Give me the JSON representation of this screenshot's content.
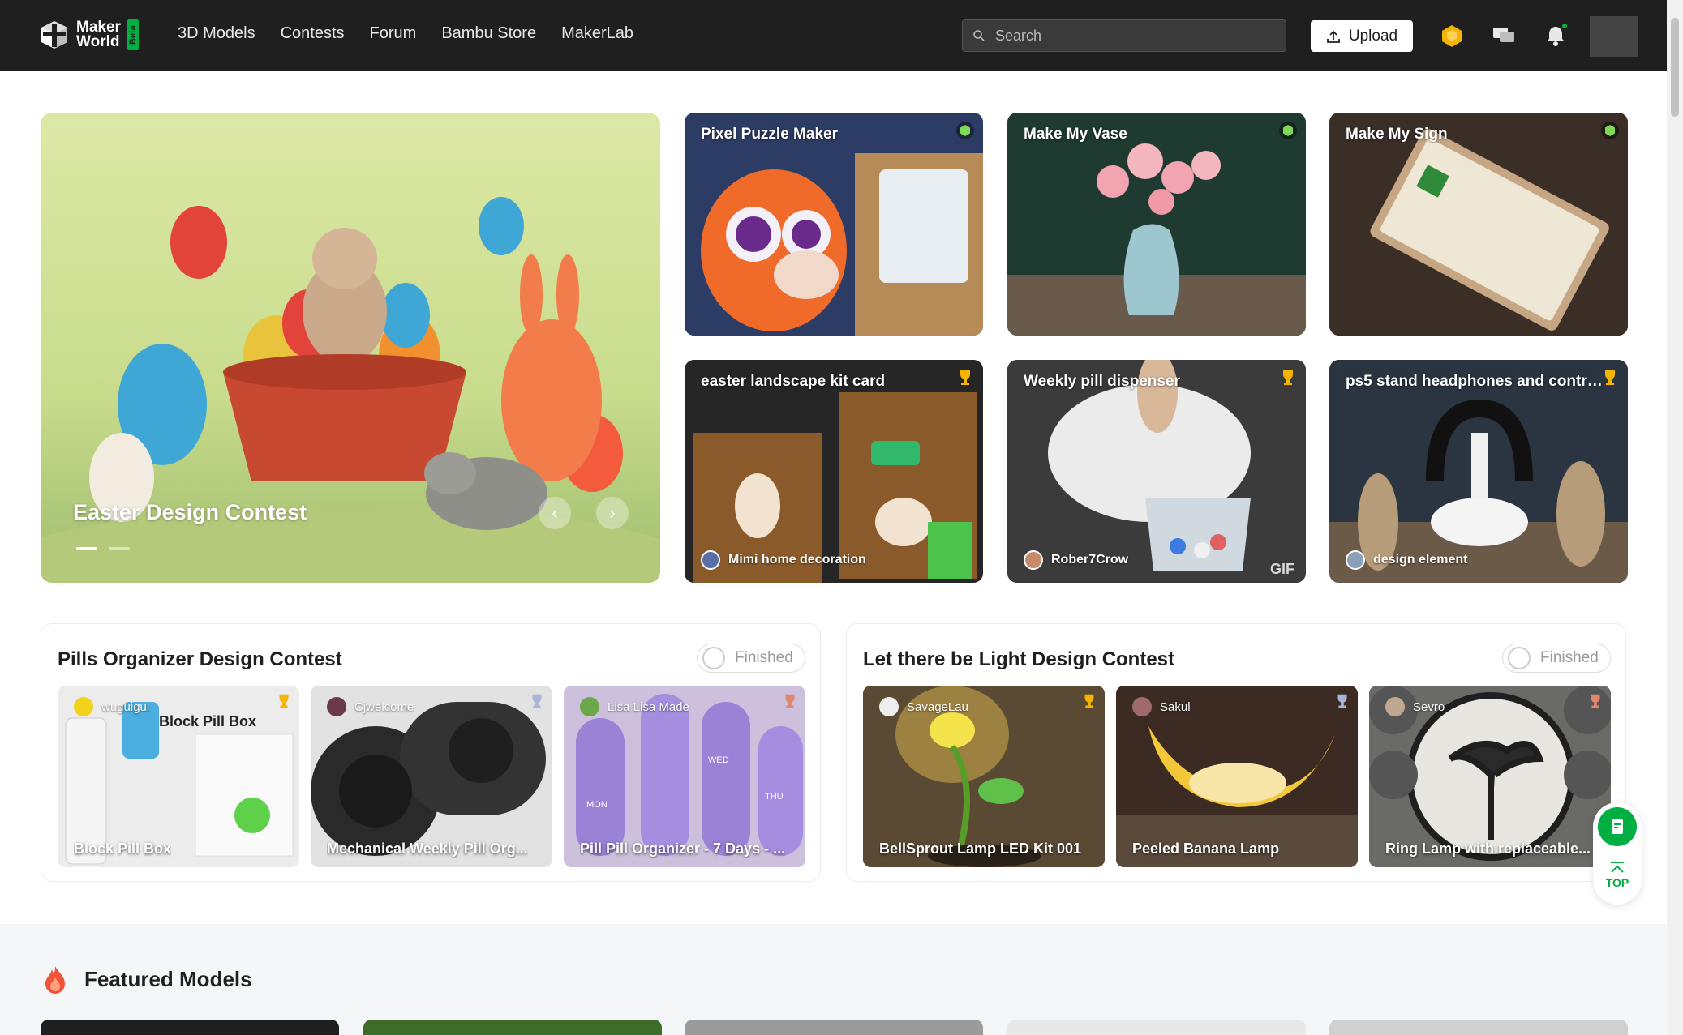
{
  "nav": {
    "logo_line1": "Maker",
    "logo_line2": "World",
    "beta": "Beta",
    "menu": [
      "3D Models",
      "Contests",
      "Forum",
      "Bambu Store",
      "MakerLab"
    ],
    "search_placeholder": "Search",
    "upload_label": "Upload",
    "accent": "#00ae42"
  },
  "hero": {
    "title": "Easter Design Contest",
    "slide_index": 1,
    "slide_count": 2
  },
  "tiles": [
    {
      "title": "Pixel Puzzle Maker",
      "badge": "makerlab-icon"
    },
    {
      "title": "Make My Vase",
      "badge": "makerlab-icon"
    },
    {
      "title": "Make My Sign",
      "badge": "makerlab-icon"
    },
    {
      "title": "easter landscape kit card",
      "badge": "trophy-icon",
      "author": "Mimi home decoration"
    },
    {
      "title": "Weekly pill dispenser",
      "badge": "trophy-icon",
      "author": "Rober7Crow",
      "tag": "GIF"
    },
    {
      "title": "ps5 stand headphones and contro...",
      "badge": "trophy-icon",
      "author": "design element"
    }
  ],
  "contests": [
    {
      "title": "Pills Organizer Design Contest",
      "status": "Finished",
      "cards": [
        {
          "author": "wuguigui",
          "title": "Block Pill Box",
          "trophy": "gold"
        },
        {
          "author": "Cjwelcome",
          "title": "Mechanical Weekly Pill Org...",
          "trophy": "silver"
        },
        {
          "author": "Lisa Lisa Made",
          "title": "Pill Pill Organizer - 7 Days - ...",
          "trophy": "bronze"
        }
      ]
    },
    {
      "title": "Let there be Light Design Contest",
      "status": "Finished",
      "cards": [
        {
          "author": "SavageLau",
          "title": "BellSprout Lamp LED Kit 001",
          "trophy": "gold"
        },
        {
          "author": "Sakul",
          "title": "Peeled Banana Lamp",
          "trophy": "silver"
        },
        {
          "author": "Sevro",
          "title": "Ring Lamp with replaceable...",
          "trophy": "bronze"
        }
      ]
    }
  ],
  "card_image_text": {
    "block_pill_box": "Block Pill Box",
    "mon": "MON",
    "wed": "WED",
    "thu": "THU"
  },
  "featured": {
    "title": "Featured Models"
  },
  "float": {
    "top_label": "TOP"
  }
}
